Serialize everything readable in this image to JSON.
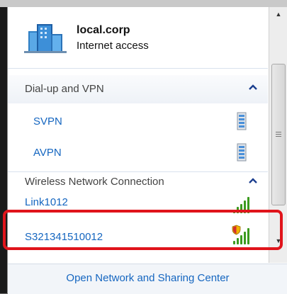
{
  "network": {
    "name": "local.corp",
    "status": "Internet access",
    "icon": "network-building-icon"
  },
  "sections": [
    {
      "title": "Dial-up and VPN",
      "collapse_glyph": "^",
      "items": [
        {
          "label": "SVPN",
          "icon": "vpn-server-icon"
        },
        {
          "label": "AVPN",
          "icon": "vpn-server-icon"
        }
      ]
    },
    {
      "title": "Wireless Network Connection",
      "collapse_glyph": "^",
      "items": [
        {
          "label": "Link1012",
          "icon": "wifi-signal-icon",
          "secured": false
        },
        {
          "label": "S321341510012",
          "icon": "wifi-signal-shield-icon",
          "secured": true,
          "highlighted": true
        }
      ]
    }
  ],
  "footer": {
    "link": "Open Network and Sharing Center"
  },
  "colors": {
    "link": "#1566c0",
    "highlight": "#e0141b",
    "signal": "#3b9a1e"
  }
}
